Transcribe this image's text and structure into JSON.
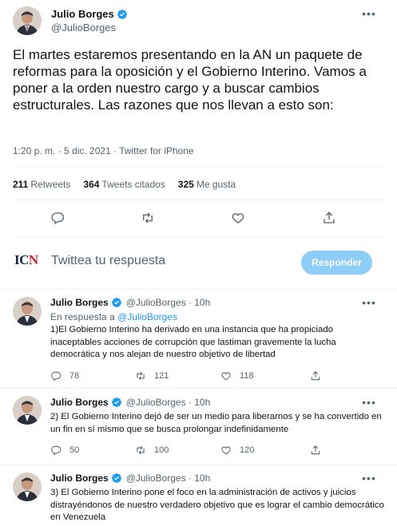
{
  "main_tweet": {
    "display_name": "Julio Borges",
    "handle": "@JulioBorges",
    "text": "El martes estaremos presentando en la AN un paquete de reformas para la oposición y el Gobierno Interino. Vamos a poner a la orden nuestro cargo y a buscar cambios estructurales. Las razones que nos llevan a esto son:",
    "timestamp": "1:20 p. m. · 5 dic. 2021 · Twitter for iPhone",
    "stats": [
      {
        "value": "211",
        "label": "Retweets"
      },
      {
        "value": "364",
        "label": "Tweets citados"
      },
      {
        "value": "325",
        "label": "Me gusta"
      }
    ],
    "actions": [
      "reply-icon",
      "retweet-icon",
      "like-icon",
      "share-icon"
    ]
  },
  "reply_composer": {
    "logo": {
      "text_main": "IC",
      "text_accent": "N"
    },
    "placeholder": "Twittea tu respuesta",
    "button_label": "Responder"
  },
  "replies": [
    {
      "display_name": "Julio Borges",
      "handle": "@JulioBorges · 10h",
      "in_reply_prefix": "En respuesta a",
      "in_reply_handle": "@JulioBorges",
      "text": "1)El Gobierno Interino ha derivado en una instancia que ha propiciado inaceptables acciones de corrupción que lastiman gravemente la lucha democrática y nos alejan de nuestro objetivo de libertad",
      "replies": "78",
      "retweets": "121",
      "likes": "118"
    },
    {
      "display_name": "Julio Borges",
      "handle": "@JulioBorges · 10h",
      "text": "2) El Gobierno Interino dejó de ser un medio para liberarnos y se ha convertido en un fin en sí mismo que se busca prolongar indefinidamente",
      "replies": "50",
      "retweets": "100",
      "likes": "120"
    },
    {
      "display_name": "Julio Borges",
      "handle": "@JulioBorges · 10h",
      "text": "3) El Gobierno Interino pone el foco en la administración de activos y juicios distrayéndonos de nuestro verdadero objetivo que es lograr el cambio democrático en Venezuela"
    }
  ],
  "colors": {
    "accent": "#1d9bf0",
    "button_disabled": "#8ecdf8",
    "secondary_text": "#536471",
    "divider": "#eff3f4"
  }
}
